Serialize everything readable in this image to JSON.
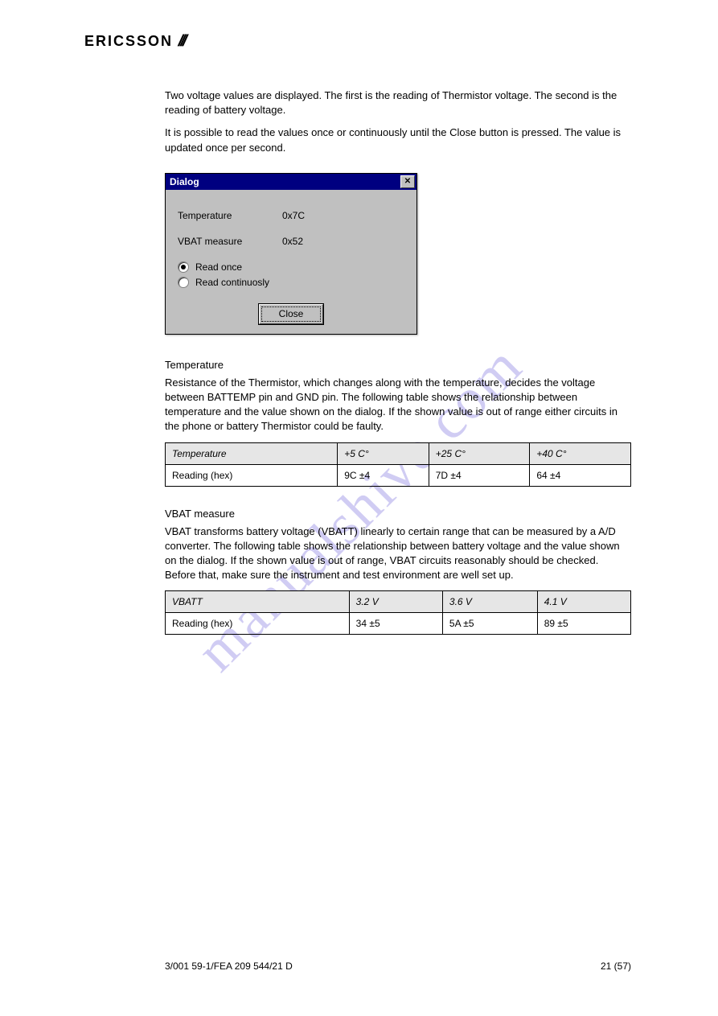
{
  "header": {
    "brand": "ERICSSON"
  },
  "watermark": "manualshive.com",
  "intro": {
    "line1": "Two voltage values are displayed. The first is the reading of Thermistor voltage. The second is the reading of battery voltage.",
    "line2": "It is possible to read the values once or continuously until the Close button is pressed. The value is updated once per second."
  },
  "dialog": {
    "title": "Dialog",
    "rows": [
      {
        "label": "Temperature",
        "value": "0x7C"
      },
      {
        "label": "VBAT measure",
        "value": "0x52"
      }
    ],
    "radios": [
      {
        "label": "Read once",
        "checked": true
      },
      {
        "label": "Read continuosly",
        "checked": false
      }
    ],
    "close_label": "Close"
  },
  "sections": {
    "temp": {
      "heading": "Temperature",
      "text": "Resistance of the Thermistor, which changes along with the temperature, decides the voltage between BATTEMP pin and GND pin. The following table shows the relationship between temperature and the value shown on the dialog. If the shown value is out of range either circuits in the phone or battery Thermistor could be faulty.",
      "table": {
        "headers": [
          "Temperature",
          "+5 C°",
          "+25 C°",
          "+40 C°"
        ],
        "rows": [
          [
            "Reading (hex)",
            "9C ±4",
            "7D ±4",
            "64 ±4"
          ]
        ]
      }
    },
    "vbat": {
      "heading": "VBAT measure",
      "text": "VBAT transforms battery voltage (VBATT) linearly to certain range that can be measured by a A/D converter. The following table shows the relationship between battery voltage and the value shown on the dialog. If the shown value is out of range, VBAT circuits reasonably should be checked. Before that, make sure the instrument and test environment are well set up.",
      "table": {
        "headers": [
          "VBATT",
          "3.2 V",
          "3.6 V",
          "4.1 V"
        ],
        "rows": [
          [
            "Reading (hex)",
            "34 ±5",
            "5A ±5",
            "89 ±5"
          ]
        ]
      }
    }
  },
  "footer": {
    "left": "3/001 59-1/FEA 209 544/21 D",
    "right": "21 (57)"
  }
}
